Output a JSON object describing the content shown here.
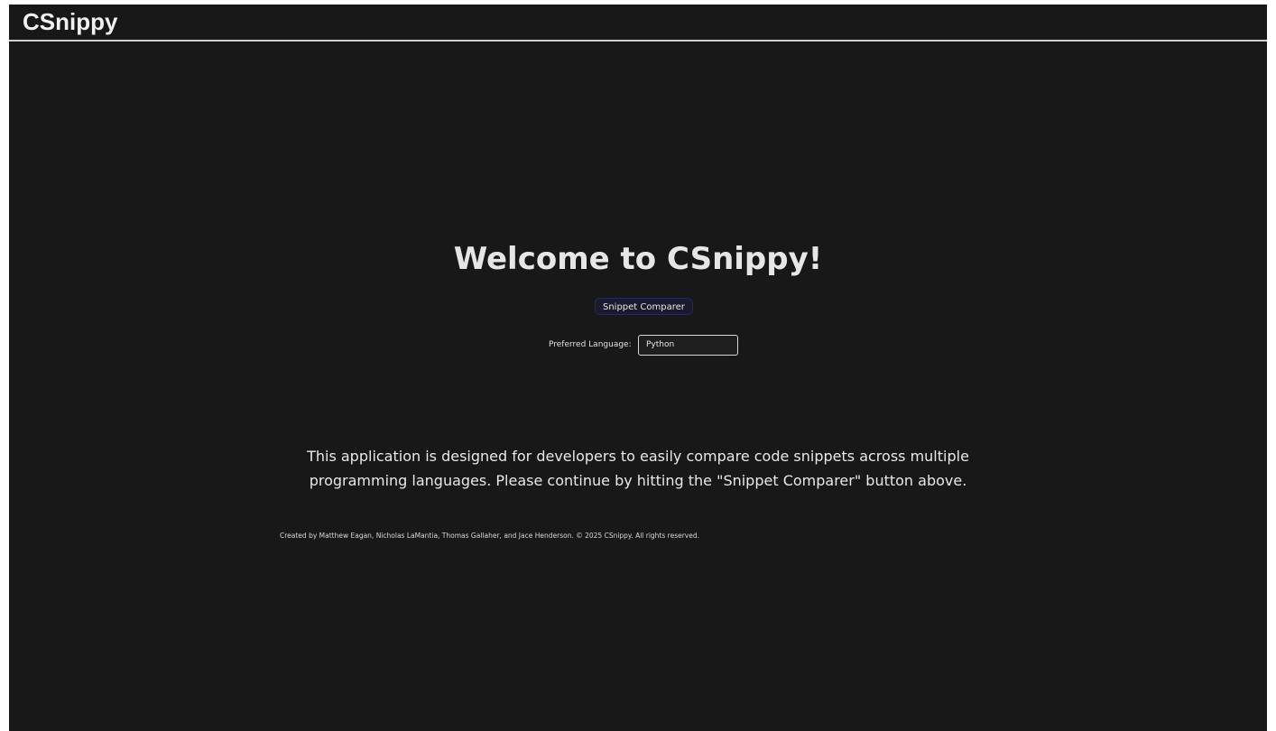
{
  "header": {
    "logo": "CSnippy"
  },
  "main": {
    "welcome_title": "Welcome to CSnippy!",
    "comparer_button": "Snippet Comparer",
    "language": {
      "label": "Preferred Language:",
      "selected": "Python"
    },
    "description_line1": "This application is designed for developers to easily compare code snippets across multiple",
    "description_line2": "programming languages. Please continue by hitting the \"Snippet Comparer\" button above."
  },
  "footer": {
    "text": "Created by Matthew Eagan, Nicholas LaMantia, Thomas Gallaher, and Jace Henderson. © 2025 CSnippy. All rights reserved."
  },
  "colors": {
    "background": "#181818",
    "text": "#e8e8e8",
    "button_bg": "#1a1a2e"
  }
}
